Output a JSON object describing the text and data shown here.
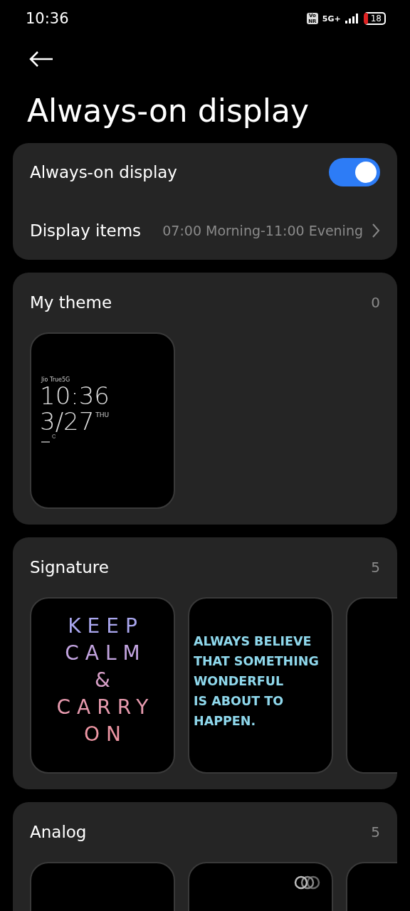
{
  "status_bar": {
    "time": "10:36",
    "network_badge": "Vo NR",
    "network": "5G+",
    "battery": "18"
  },
  "title": "Always-on display",
  "settings": [
    {
      "kind": "toggle",
      "label": "Always-on display",
      "on": true
    },
    {
      "kind": "link",
      "label": "Display items",
      "value": "07:00 Morning-11:00 Evening"
    }
  ],
  "sections": [
    {
      "title": "My theme",
      "count": "0",
      "items": [
        {
          "kind": "clock",
          "carrier": "Jio True5G",
          "time": "10:36",
          "date": "3/27",
          "day": "THU"
        }
      ]
    },
    {
      "title": "Signature",
      "count": "5",
      "items": [
        {
          "kind": "stacked",
          "lines": [
            {
              "text": "KEEP",
              "color": "#a9a6ee"
            },
            {
              "text": "CALM",
              "color": "#c3a4e0"
            },
            {
              "text": "&",
              "color": "#d8a0c8"
            },
            {
              "text": "CARRY",
              "color": "#e79aae"
            },
            {
              "text": "ON",
              "color": "#ee96a4"
            }
          ]
        },
        {
          "kind": "quote",
          "lines": [
            "ALWAYS BELIEVE",
            "THAT SOMETHING",
            "WONDERFUL",
            "IS ABOUT TO",
            "HAPPEN."
          ]
        },
        {
          "kind": "blank"
        }
      ]
    },
    {
      "title": "Analog",
      "count": "5",
      "items": [
        {
          "kind": "blank"
        },
        {
          "kind": "rings"
        },
        {
          "kind": "blank"
        }
      ]
    }
  ]
}
